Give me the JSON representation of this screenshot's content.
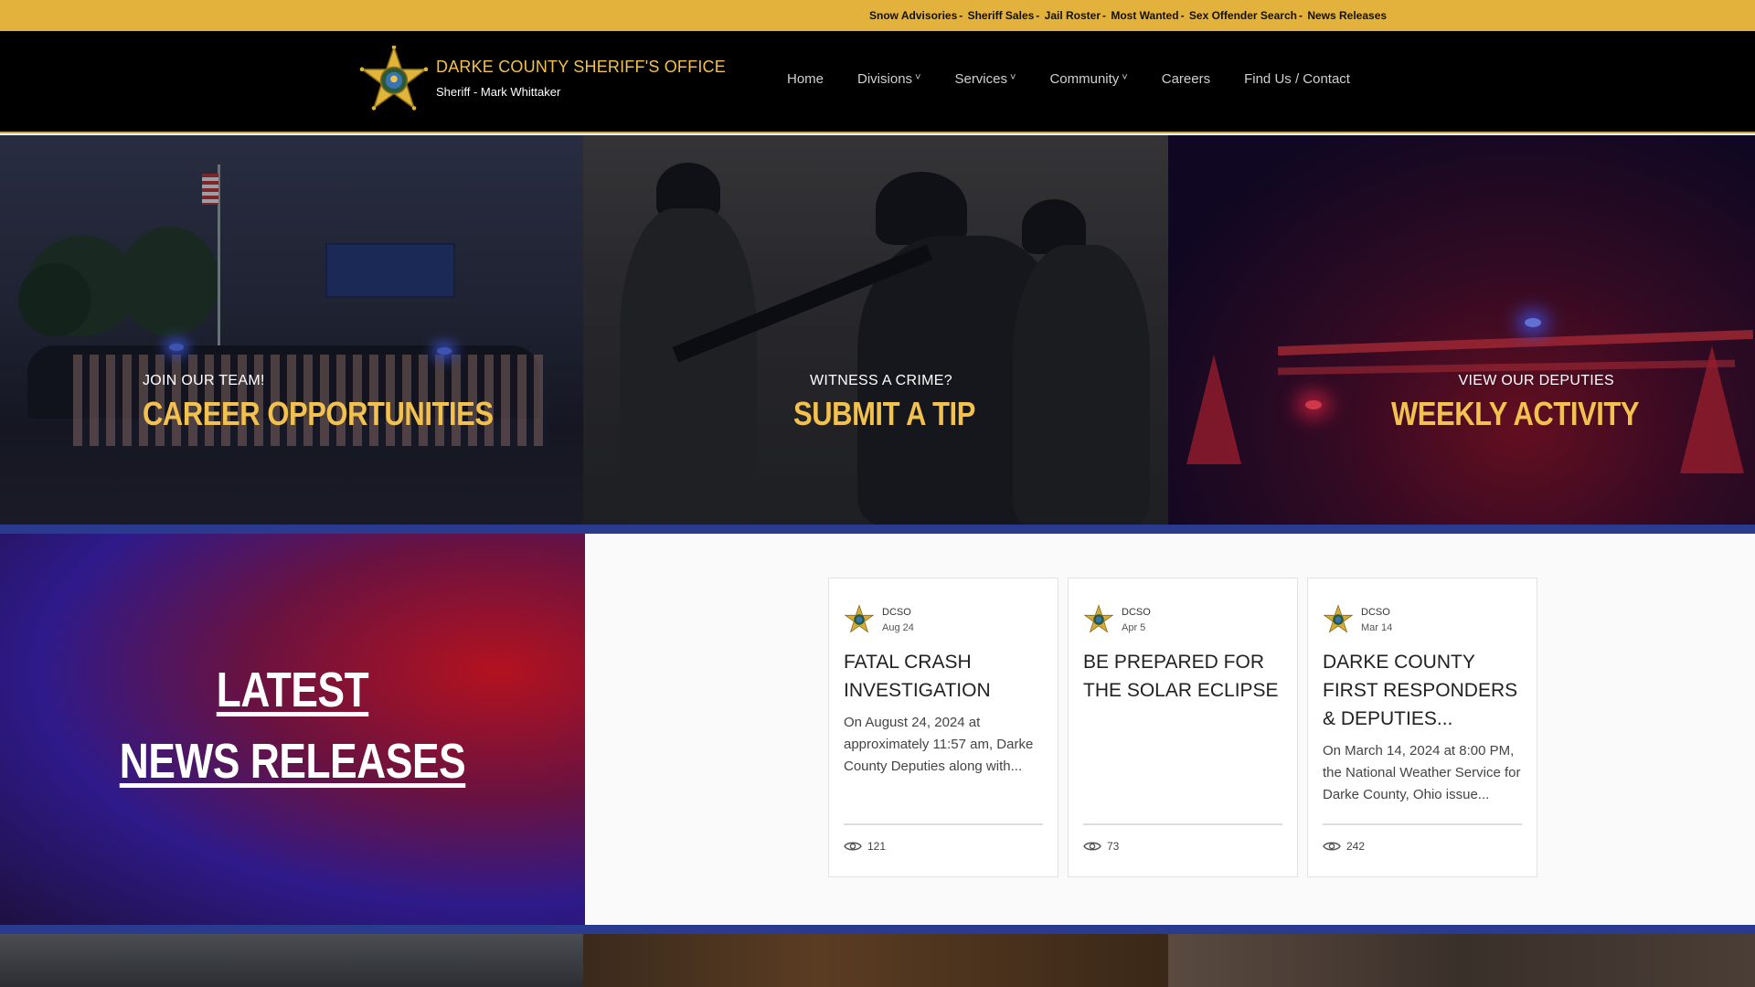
{
  "alert_bar": {
    "links": [
      "Snow Advisories",
      "Sheriff Sales",
      "Jail Roster",
      "Most Wanted",
      "Sex Offender Search",
      "News Releases"
    ],
    "separator": "-",
    "color": "#e3b23c"
  },
  "header": {
    "title": "DARKE COUNTY SHERIFF'S OFFICE",
    "subtitle": "Sheriff - Mark Whittaker",
    "badge_icon": "sheriff-star-badge",
    "accent_color": "#f2c14e"
  },
  "nav": {
    "home": "Home",
    "divisions": "Divisions",
    "services": "Services",
    "community": "Community",
    "careers": "Careers",
    "contact": "Find Us / Contact",
    "caret": "˅"
  },
  "tiles": [
    {
      "kicker": "JOIN OUR TEAM!",
      "headline": "CAREER OPPORTUNITIES"
    },
    {
      "kicker": "WITNESS A CRIME?",
      "headline": "SUBMIT A TIP"
    },
    {
      "kicker": "VIEW OUR DEPUTIES",
      "headline": "WEEKLY ACTIVITY"
    }
  ],
  "news": {
    "title_line1": "LATEST",
    "title_line2": "NEWS RELEASES",
    "posts": [
      {
        "author": "DCSO",
        "date": "Aug 24",
        "title": "FATAL CRASH INVESTIGATION",
        "excerpt": "On August 24, 2024 at approximately 11:57 am, Darke County Deputies along with...",
        "views": "121"
      },
      {
        "author": "DCSO",
        "date": "Apr 5",
        "title": "BE PREPARED FOR THE SOLAR ECLIPSE",
        "excerpt": "",
        "views": "73"
      },
      {
        "author": "DCSO",
        "date": "Mar 14",
        "title": "DARKE COUNTY FIRST RESPONDERS & DEPUTIES...",
        "excerpt": "On March 14, 2024 at 8:00 PM, the National Weather Service for Darke County, Ohio issue...",
        "views": "242"
      }
    ],
    "views_icon": "eye-icon"
  },
  "colors": {
    "divider_blue": "#2a3a8f",
    "header_black": "#000000"
  }
}
